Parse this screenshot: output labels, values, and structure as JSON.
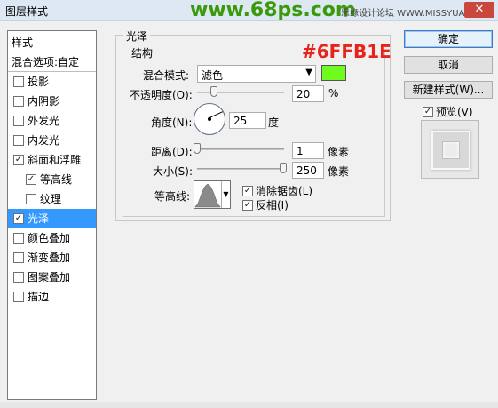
{
  "window": {
    "title": "图层样式",
    "watermark": "www.68ps.com",
    "site_text": "思缘设计论坛 WWW.MISSYUAN.COM",
    "close_glyph": "✕"
  },
  "style_list": {
    "header": "样式",
    "blend_options": "混合选项:自定",
    "items": [
      {
        "label": "投影",
        "checked": false
      },
      {
        "label": "内阴影",
        "checked": false
      },
      {
        "label": "外发光",
        "checked": false
      },
      {
        "label": "内发光",
        "checked": false
      },
      {
        "label": "斜面和浮雕",
        "checked": true
      },
      {
        "label": "等高线",
        "checked": true
      },
      {
        "label": "纹理",
        "checked": false
      },
      {
        "label": "光泽",
        "checked": true
      },
      {
        "label": "颜色叠加",
        "checked": false
      },
      {
        "label": "渐变叠加",
        "checked": false
      },
      {
        "label": "图案叠加",
        "checked": false
      },
      {
        "label": "描边",
        "checked": false
      }
    ]
  },
  "satin": {
    "group_title": "光泽",
    "structure_title": "结构",
    "annotation": "#6FFB1E",
    "blend_mode_label": "混合模式:",
    "blend_mode_value": "滤色",
    "color": "#6ffb1e",
    "opacity_label": "不透明度(O):",
    "opacity_value": "20",
    "opacity_unit": "%",
    "angle_label": "角度(N):",
    "angle_value": "25",
    "angle_unit": "度",
    "distance_label": "距离(D):",
    "distance_value": "1",
    "distance_unit": "像素",
    "size_label": "大小(S):",
    "size_value": "250",
    "size_unit": "像素",
    "contour_label": "等高线:",
    "antialias_label": "消除锯齿(L)",
    "antialias_checked": true,
    "invert_label": "反相(I)",
    "invert_checked": true
  },
  "buttons": {
    "ok": "确定",
    "cancel": "取消",
    "new_style": "新建样式(W)...",
    "preview_label": "预览(V)",
    "preview_checked": true
  },
  "icons": {
    "check": "✓",
    "dropdown": "▼"
  }
}
